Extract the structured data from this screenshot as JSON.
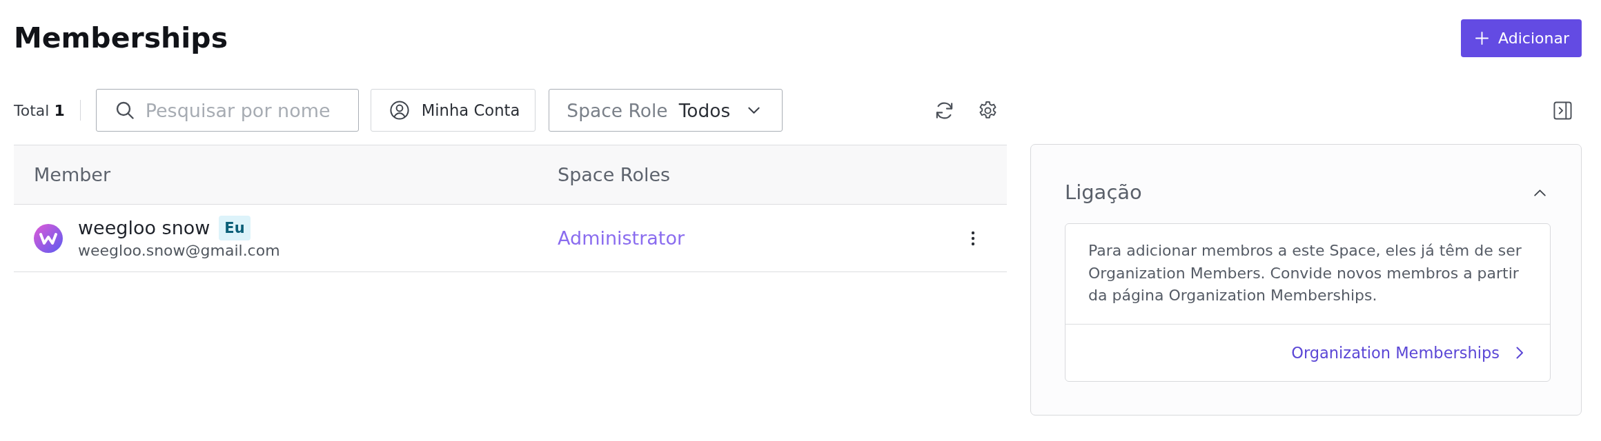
{
  "page": {
    "title": "Memberships",
    "add_button": {
      "label": "Adicionar"
    }
  },
  "toolbar": {
    "total": "Total **1**",
    "search": {
      "placeholder": "Pesquisar por nome"
    },
    "my_account_button": {
      "label": "Minha Conta"
    },
    "role_filter": {
      "label": "Space Role",
      "value": "Todos"
    }
  },
  "table": {
    "columns": [
      "Member",
      "Space Roles"
    ],
    "rows": [
      {
        "name": "weegloo snow",
        "badge": "Eu",
        "email": "weegloo.snow@gmail.com",
        "role": "Administrator"
      }
    ]
  },
  "side_panel": {
    "title": "Ligação",
    "expanded": true,
    "message": "Para adicionar membros a este Space, eles já têm de ser Organization Members. Convide novos membros a partir da página Organization Memberships.",
    "link": "Organization Memberships"
  }
}
